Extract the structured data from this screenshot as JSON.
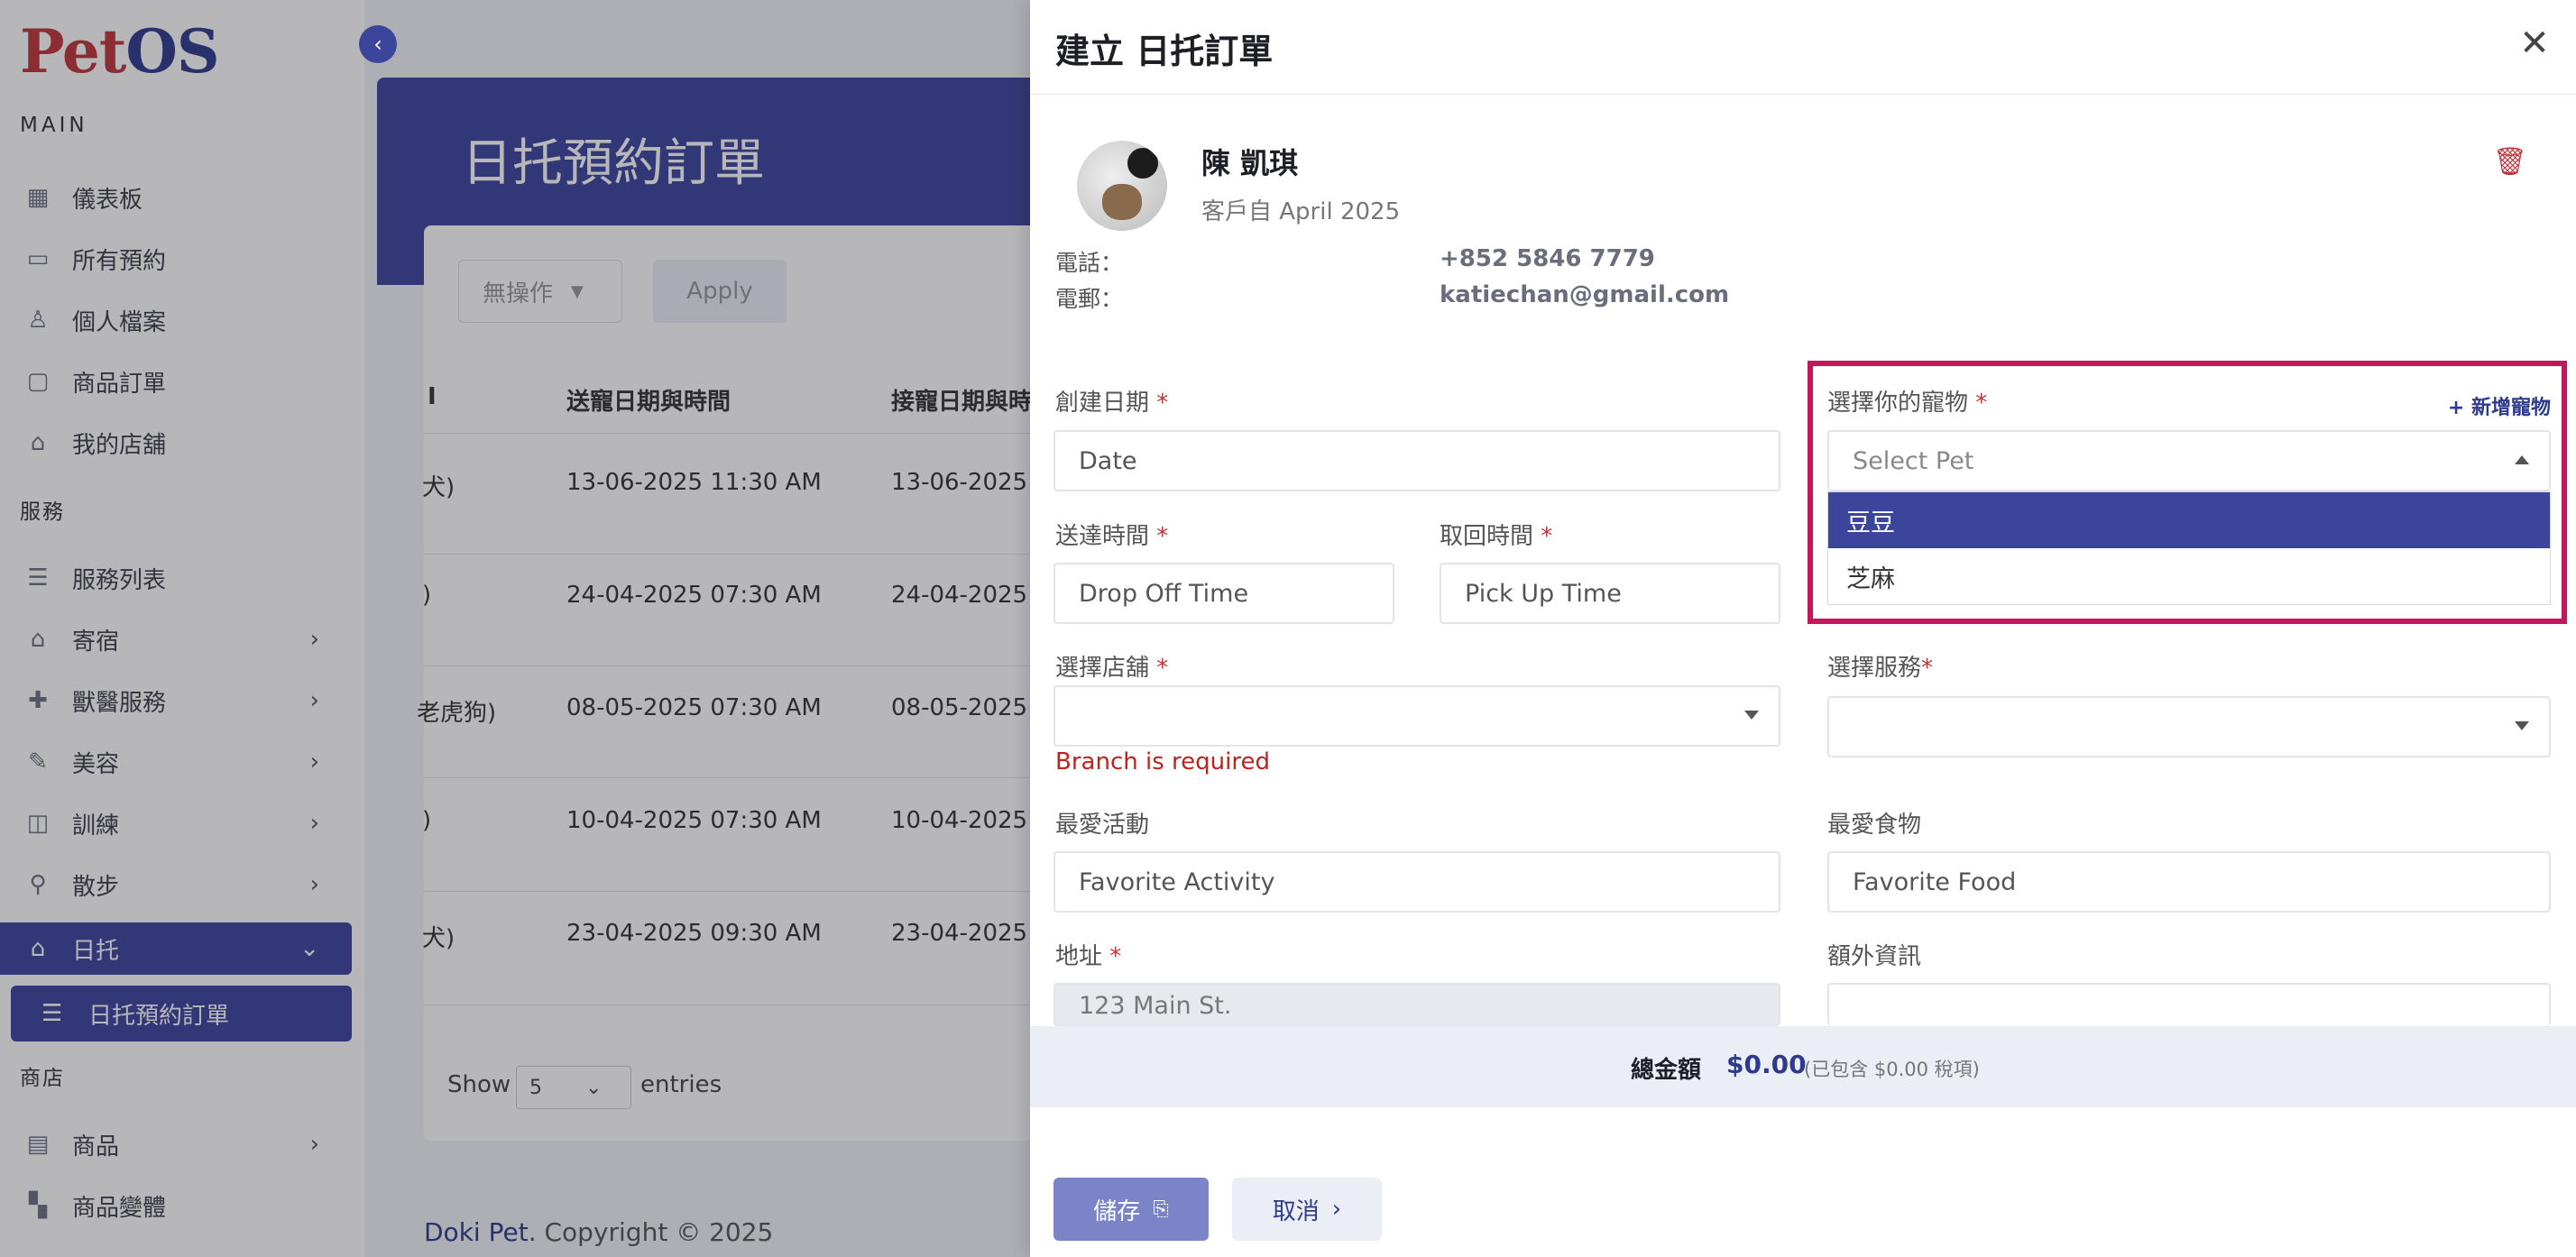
{
  "brand": {
    "logo_p": "P",
    "logo_et": "et",
    "logo_os": "OS"
  },
  "sidebar": {
    "section_main": "MAIN",
    "section_service": "服務",
    "section_shop": "商店",
    "items": [
      {
        "label": "儀表板",
        "icon": "grid-icon"
      },
      {
        "label": "所有預約",
        "icon": "calendar-icon"
      },
      {
        "label": "個人檔案",
        "icon": "user-icon"
      },
      {
        "label": "商品訂單",
        "icon": "bag-icon"
      },
      {
        "label": "我的店舖",
        "icon": "store-icon"
      },
      {
        "label": "服務列表",
        "icon": "list-icon"
      },
      {
        "label": "寄宿",
        "icon": "home-icon"
      },
      {
        "label": "獸醫服務",
        "icon": "vet-icon"
      },
      {
        "label": "美容",
        "icon": "brush-icon"
      },
      {
        "label": "訓練",
        "icon": "bowl-icon"
      },
      {
        "label": "散步",
        "icon": "walk-icon"
      },
      {
        "label": "日托",
        "icon": "daycare-icon"
      },
      {
        "label": "商品",
        "icon": "shop-icon"
      },
      {
        "label": "商品變體",
        "icon": "variants-icon"
      }
    ],
    "sub_active": "日托預約訂單"
  },
  "background": {
    "page_title": "日托預約訂單",
    "bulk_action": "無操作",
    "apply": "Apply",
    "col1": "送寵日期與時間",
    "col2": "接寵日期與時間",
    "rows": [
      {
        "pet": "犬)",
        "drop": "13-06-2025 11:30 AM",
        "pick": "13-06-2025"
      },
      {
        "pet": ")",
        "drop": "24-04-2025 07:30 AM",
        "pick": "24-04-2025"
      },
      {
        "pet": "老虎狗)",
        "drop": "08-05-2025 07:30 AM",
        "pick": "08-05-2025"
      },
      {
        "pet": ")",
        "drop": "10-04-2025 07:30 AM",
        "pick": "10-04-2025"
      },
      {
        "pet": "犬)",
        "drop": "23-04-2025 09:30 AM",
        "pick": "23-04-2025"
      }
    ],
    "show": "Show",
    "entries_value": "5",
    "entries": "entries",
    "footer_brand": "Doki Pet",
    "footer_rest": ". Copyright © 2025"
  },
  "drawer": {
    "title": "建立 日托訂單",
    "customer": {
      "name": "陳 凱琪",
      "since": "客戶自 April 2025",
      "phone_label": "電話：",
      "phone": "+852 5846 7779",
      "email_label": "電郵：",
      "email": "katiechan@gmail.com"
    },
    "fields": {
      "created_date_label": "創建日期",
      "created_date_ph": "Date",
      "dropoff_label": "送達時間",
      "dropoff_ph": "Drop Off Time",
      "pickup_label": "取回時間",
      "pickup_ph": "Pick Up Time",
      "branch_label": "選擇店舖",
      "branch_error": "Branch is required",
      "pet_label": "選擇你的寵物",
      "pet_ph": "Select Pet",
      "add_pet": "+ 新增寵物",
      "pet_options": [
        "豆豆",
        "芝麻"
      ],
      "service_label": "選擇服務",
      "fav_activity_label": "最愛活動",
      "fav_activity_ph": "Favorite Activity",
      "fav_food_label": "最愛食物",
      "fav_food_ph": "Favorite Food",
      "address_label": "地址",
      "address_value": "123 Main St.",
      "extra_label": "額外資訊"
    },
    "total": {
      "label": "總金額",
      "value": "$0.00",
      "tax": "(已包含 $0.00 稅項)"
    },
    "save": "儲存",
    "cancel": "取消"
  },
  "colors": {
    "primary": "#3b459c",
    "danger": "#c0343a",
    "highlight": "#c2185b"
  }
}
